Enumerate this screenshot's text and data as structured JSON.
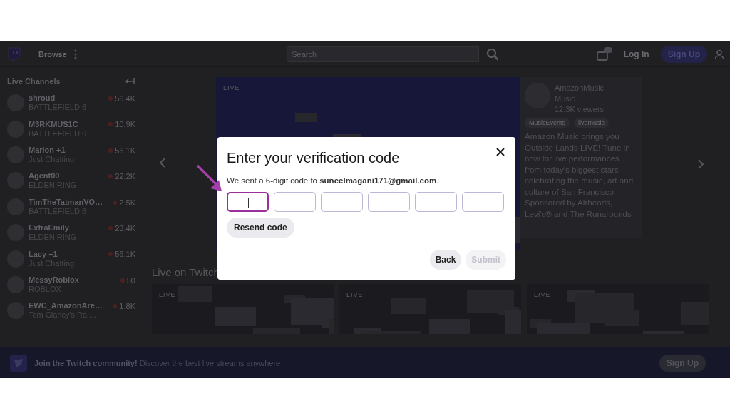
{
  "topbar": {
    "browse": "Browse",
    "search": {
      "placeholder": "Search"
    },
    "login": "Log In",
    "signup": "Sign Up"
  },
  "sidebar": {
    "title": "Live Channels",
    "channels": [
      {
        "name": "shroud",
        "category": "BATTLEFIELD 6",
        "viewers": "56.4K"
      },
      {
        "name": "M3RKMUS1C",
        "category": "BATTLEFIELD 6",
        "viewers": "10.9K"
      },
      {
        "name": "Marlon +1",
        "category": "Just Chatting",
        "viewers": "56.1K"
      },
      {
        "name": "Agent00",
        "category": "ELDEN RING",
        "viewers": "22.2K"
      },
      {
        "name": "TimTheTatmanVO…",
        "category": "BATTLEFIELD 6",
        "viewers": "2.5K"
      },
      {
        "name": "ExtraEmily",
        "category": "ELDEN RING",
        "viewers": "23.4K"
      },
      {
        "name": "Lacy +1",
        "category": "Just Chatting",
        "viewers": "56.1K"
      },
      {
        "name": "MessyRoblox",
        "category": "ROBLOX",
        "viewers": "50"
      },
      {
        "name": "EWC_AmazonAre…",
        "category": "Tom Clancy's Rai…",
        "viewers": "1.8K"
      }
    ]
  },
  "featured": {
    "live": "LIVE",
    "channel": "AmazonMusic",
    "category": "Music",
    "viewers": "12.3K viewers",
    "tags": [
      "MusicEvents",
      "livemusic"
    ],
    "description": "Amazon Music brings you Outside Lands LIVE! Tune in now for live performances from today's biggest stars celebrating the music, art and culture of San Francisco. Sponsored by Airheads, Levi's® and The Runarounds"
  },
  "live_section": {
    "title": "Live on Twitch",
    "streams": [
      {
        "live": "LIVE"
      },
      {
        "live": "LIVE"
      },
      {
        "live": "LIVE"
      }
    ]
  },
  "banner": {
    "title": "Join the Twitch community!",
    "text": "Discover the best live streams anywhere",
    "button": "Sign Up"
  },
  "modal": {
    "title": "Enter your verification code",
    "message": "We sent a 6-digit code to **suneelmagani171@gmail.com**.",
    "digits": [
      {
        "focused": true
      },
      {
        "focused": false
      },
      {
        "focused": false
      },
      {
        "focused": false
      },
      {
        "focused": false
      },
      {
        "focused": false
      }
    ],
    "resend": "Resend code",
    "buttons": [
      {
        "label": "Back",
        "disabled": false
      },
      {
        "label": "Submit",
        "disabled": true
      }
    ]
  }
}
